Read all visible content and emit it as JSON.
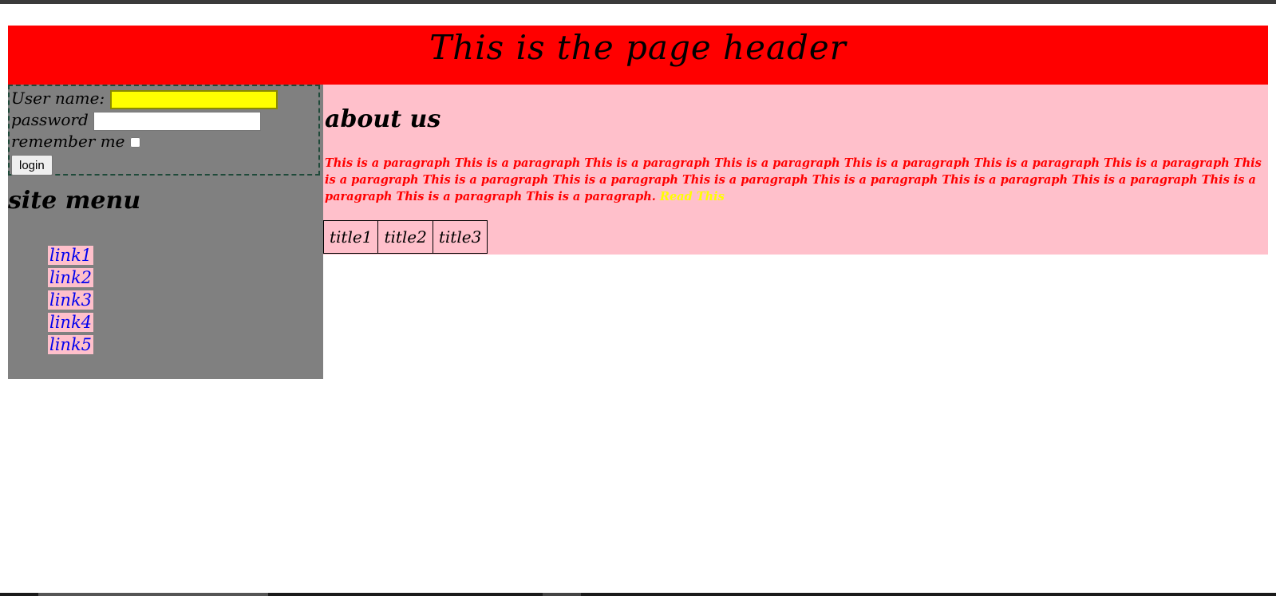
{
  "header": {
    "title": "This is the page header"
  },
  "login": {
    "username_label": "User name:",
    "username_value": "",
    "password_label": "password",
    "password_value": "",
    "remember_label": "remember me",
    "remember_checked": false,
    "button_label": "login"
  },
  "sidebar": {
    "menu_title": "site menu",
    "links": [
      {
        "label": "link1"
      },
      {
        "label": "link2"
      },
      {
        "label": "link3"
      },
      {
        "label": "link4"
      },
      {
        "label": "link5"
      }
    ]
  },
  "main": {
    "heading": "about us",
    "paragraph": "This is a paragraph This is a paragraph This is a paragraph This is a paragraph This is a paragraph This is a paragraph This is a paragraph This is a paragraph This is a paragraph This is a paragraph This is a paragraph This is a paragraph This is a paragraph This is a paragraph This is a paragraph This is a paragraph This is a paragraph.",
    "read_link": "Read This",
    "table_titles": [
      "title1",
      "title2",
      "title3"
    ]
  },
  "colors": {
    "header_bg": "#ff0000",
    "sidebar_bg": "#808080",
    "main_bg": "#ffc0cb",
    "username_field_bg": "#ffff00",
    "paragraph_text": "#ff0000",
    "read_link": "#ffff00",
    "menu_link": "#0000ee",
    "menu_link_bg": "#ffc0cb"
  }
}
